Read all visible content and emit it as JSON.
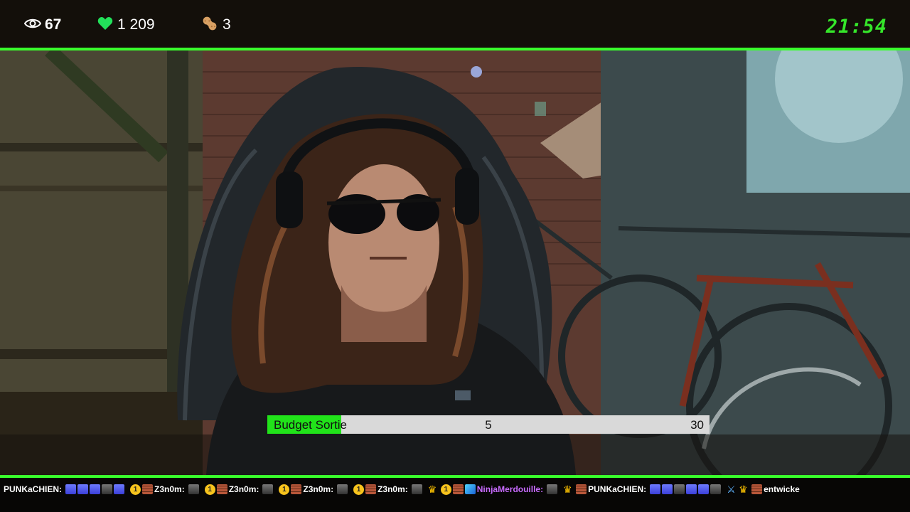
{
  "stats": {
    "viewers": "67",
    "followers": "1 209",
    "subs": "3",
    "clock": "21:54"
  },
  "budget": {
    "label": "Budget Sortie",
    "current": "5",
    "max": "30",
    "progress_fraction": 0.167
  },
  "chat": {
    "users": [
      "PUNKaCHIEN:",
      "Z3n0m:",
      "Z3n0m:",
      "Z3n0m:",
      "Z3n0m:",
      "NinjaMerdouille:",
      "PUNKaCHIEN:",
      "entwicke"
    ],
    "badge_coin_text": "1"
  },
  "colors": {
    "accent_green": "#39ff2c",
    "clock_green": "#35e62a",
    "heart_green": "#22e05a",
    "budget_fill": "#21e31a",
    "ninja_purple": "#c86bff"
  },
  "icons": {
    "viewers": "eye-icon",
    "followers": "heart-icon",
    "subs": "peanut-icon"
  }
}
